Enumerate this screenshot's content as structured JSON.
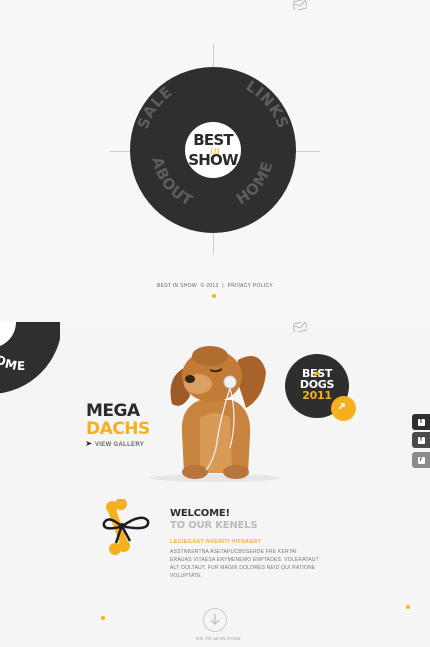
{
  "menu": {
    "logo_line1": "BEST",
    "logo_script": "in",
    "logo_line2": "SHOW",
    "items": [
      {
        "label": "SALE"
      },
      {
        "label": "LINKS"
      },
      {
        "label": "HOME"
      },
      {
        "label": "ABOUT"
      }
    ]
  },
  "footer": {
    "site_name": "BEST IN SHOW",
    "copyright": "© 2012",
    "separator": "|",
    "privacy_label": "PRIVACY POLICY"
  },
  "side_menu": {
    "label": "HOME"
  },
  "promo": {
    "line1": "MEGA",
    "line2": "DACHS",
    "gallery_label": "VIEW GALLERY"
  },
  "badge": {
    "line1": "BEST",
    "line2": "DOGS",
    "line3": "2011"
  },
  "social": [
    {
      "icon": "twitter-icon",
      "glyph": "t"
    },
    {
      "icon": "facebook-icon",
      "glyph": "f"
    },
    {
      "icon": "rss-icon",
      "glyph": "r"
    }
  ],
  "welcome": {
    "title": "WELCOME!",
    "subtitle": "TO OUR KENELS",
    "heading": "LECIEGAST NVERITI VITSAERT",
    "body": "ASSTNKERTNA ASETAPUCBOSERDE FRE KERTAI ERAUAS VITAESA ERYMENEMO ENPTADES. VOLERATAUT ALT OOLTAUT. FUR MAGNI DOLORES NEID QUI RATIONE VOLUPTATE."
  },
  "go_main": {
    "label": "GO TO MAIN PAGE"
  },
  "colors": {
    "accent": "#f6b01e",
    "dark": "#2e2e2e",
    "background": "#f6f6f6"
  }
}
